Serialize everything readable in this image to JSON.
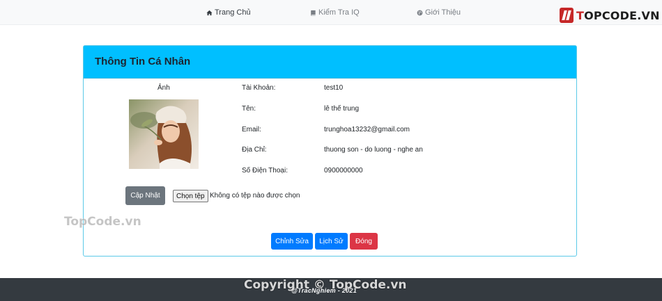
{
  "nav": {
    "home": "Trang Chủ",
    "iq_test": "Kiểm Tra IQ",
    "about": "Giới Thiệu",
    "home_icon": "home-icon",
    "iq_icon": "book-icon",
    "about_icon": "globe-icon"
  },
  "brand": {
    "name_prefix": "T",
    "name_rest": "OPCODE.VN",
    "color": "#c62828"
  },
  "profile": {
    "title": "Thông Tin Cá Nhân",
    "photo_label": "Ảnh",
    "fields": [
      {
        "label": "Tài Khoản:",
        "value": "test10"
      },
      {
        "label": "Tên:",
        "value": "lê thế trung"
      },
      {
        "label": "Email:",
        "value": "trunghoa13232@gmail.com"
      },
      {
        "label": "Địa Chỉ:",
        "value": "thuong son - do luong - nghe an"
      },
      {
        "label": "Số Điện Thoại:",
        "value": "0900000000"
      }
    ],
    "update_button": "Cập Nhật",
    "file_button": "Chọn tệp",
    "file_status": "Không có tệp nào được chọn",
    "edit_button": "Chỉnh Sửa",
    "history_button": "Lịch Sử",
    "close_button": "Đóng",
    "header_color": "#00bfff"
  },
  "watermark": {
    "side": "TopCode.vn",
    "footer": "Copyright © TopCode.vn"
  },
  "footer": {
    "text": "@TracNghiem - 2021"
  }
}
